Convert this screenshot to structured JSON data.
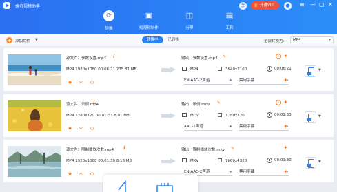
{
  "app": {
    "title": "金舟视频助手",
    "vip_label": "开通VIP"
  },
  "window_controls": {
    "minimize": "—",
    "maximize": "▢",
    "close": "✕"
  },
  "tabs": [
    {
      "label": "转换",
      "icon": "convert-icon",
      "active": true
    },
    {
      "label": "短视频制作",
      "icon": "short-video-icon",
      "active": false
    },
    {
      "label": "分屏",
      "icon": "split-screen-icon",
      "active": false
    },
    {
      "label": "工具",
      "icon": "toolbox-icon",
      "active": false
    }
  ],
  "toolbar": {
    "add_icon": "+",
    "add_file_label": "添加文件",
    "status_tabs": [
      "转换中",
      "已转换"
    ],
    "output_format_label": "全部转换为:",
    "output_format_value": "MP4"
  },
  "files": [
    {
      "source_name": "源文件：参数设置.mp4",
      "source_meta": "MP4   1920x1080   00:06:21   275.81 MB",
      "output_name": "输出：参数设置.mp4",
      "out_format": "MP4",
      "out_resolution": "3840x2160",
      "out_duration": "00:06:21",
      "audio": "EN-AAC-2声道",
      "subtitle": "禁用字幕"
    },
    {
      "source_name": "源文件：示例.mp4",
      "source_meta": "MP4   1280x720   00:01:33   8.01 MB",
      "output_name": "输出：示例.mov",
      "out_format": "MOV",
      "out_resolution": "1280x720",
      "out_duration": "00:01:33",
      "audio": "AAC-2声道",
      "subtitle": "禁用字幕"
    },
    {
      "source_name": "源文件：限制播放次数.mp4",
      "source_meta": "MP4   1920x1080   00:01:30   8.18 MB",
      "output_name": "输出：限制播放次数.mkv",
      "out_format": "MKV",
      "out_resolution": "7680x4320",
      "out_duration": "00:01:30",
      "audio": "EN-AAC-2声道",
      "subtitle": "禁用字幕"
    }
  ],
  "icons": {
    "info": "i",
    "edit": "✎",
    "cut": "✂",
    "effect": "✸",
    "subtitle": "⊙",
    "settings": "✦"
  },
  "colors": {
    "brand": "#2a7ff5",
    "accent": "#ff7a1a",
    "vip": "#f0533d"
  }
}
